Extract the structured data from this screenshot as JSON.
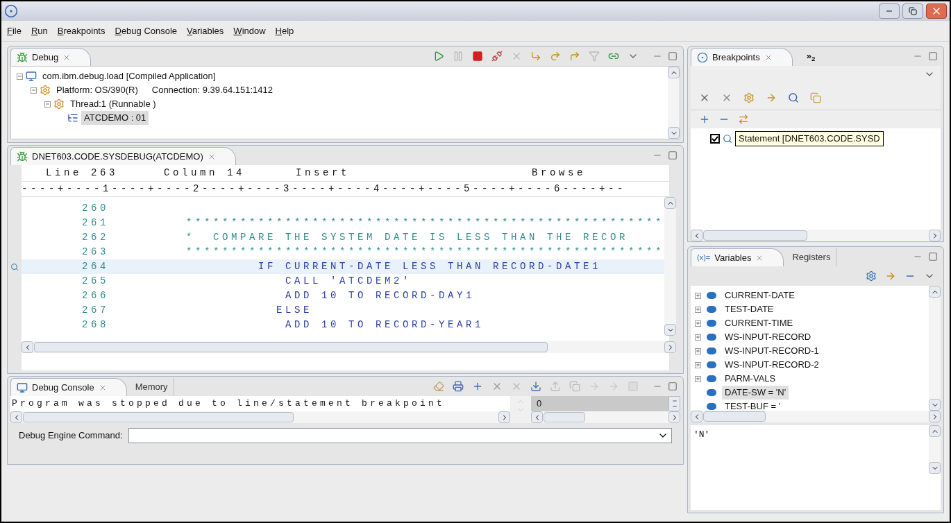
{
  "menu": [
    "File",
    "Run",
    "Breakpoints",
    "Debug Console",
    "Variables",
    "Window",
    "Help"
  ],
  "debug_view": {
    "tabs": [
      {
        "label": "Debug",
        "selected": true
      }
    ],
    "tree": [
      {
        "label": "com.ibm.debug.load [Compiled Application]",
        "kind": "application",
        "expanded": true,
        "selected": false,
        "children": [
          {
            "label": "Platform: OS/390(R)",
            "detail": "Connection: 9.39.64.151:1412",
            "kind": "platform",
            "expanded": true,
            "selected": false,
            "children": [
              {
                "label": "Thread:1 (Runnable )",
                "kind": "thread",
                "expanded": true,
                "selected": false,
                "children": [
                  {
                    "label": "ATCDEMO : 01",
                    "kind": "frame",
                    "selected": true
                  }
                ]
              }
            ]
          }
        ]
      }
    ]
  },
  "editor": {
    "tabs": [
      {
        "label": "DNET603.CODE.SYSDEBUG(ATCDEMO)",
        "selected": true
      }
    ],
    "status": [
      "Line 263",
      "Column 14",
      "Insert",
      "Browse"
    ],
    "ruler": "----+----1----+----2----+----3----+----4----+----5----+----6----+--",
    "lines": [
      {
        "number": "260",
        "selected": false,
        "breakpoint": false
      },
      {
        "number": "261",
        "text": "*****************************************************",
        "kind": "comment",
        "selected": false,
        "breakpoint": false
      },
      {
        "number": "262",
        "text": "*  COMPARE THE SYSTEM DATE IS LESS THAN THE RECOR",
        "kind": "comment",
        "selected": false,
        "breakpoint": false
      },
      {
        "number": "263",
        "text": "*****************************************************",
        "kind": "comment",
        "selected": false,
        "breakpoint": false
      },
      {
        "number": "264",
        "text": "        IF CURRENT-DATE LESS THAN RECORD-DATE1",
        "kind": "code",
        "selected": true,
        "breakpoint": true
      },
      {
        "number": "265",
        "text": "           CALL 'ATCDEM2'",
        "kind": "code",
        "selected": false,
        "breakpoint": false
      },
      {
        "number": "266",
        "text": "           ADD 10 TO RECORD-DAY1",
        "kind": "code",
        "selected": false,
        "breakpoint": false
      },
      {
        "number": "267",
        "text": "          ELSE",
        "kind": "code",
        "selected": false,
        "breakpoint": false
      },
      {
        "number": "268",
        "text": "           ADD 10 TO RECORD-YEAR1",
        "kind": "code",
        "selected": false,
        "breakpoint": false
      }
    ]
  },
  "console": {
    "tabs": [
      {
        "label": "Debug Console",
        "selected": true
      },
      {
        "label": "Memory",
        "selected": false
      }
    ],
    "output": "Program was stopped due to line/statement breakpoint",
    "value": "0",
    "command_label": "Debug Engine Command:"
  },
  "breakpoints": {
    "tabs": [
      {
        "label": "Breakpoints",
        "selected": true
      }
    ],
    "overflow": "»$_{2}$",
    "items": [
      {
        "label": "Statement [DNET603.CODE.SYSD",
        "checked": true
      }
    ]
  },
  "variables": {
    "tabs": [
      {
        "label": "Variables",
        "icon": "(x)=",
        "selected": true
      },
      {
        "label": "Registers",
        "selected": false
      }
    ],
    "items": [
      {
        "name": "CURRENT-DATE",
        "kind": "group",
        "selected": false
      },
      {
        "name": "TEST-DATE",
        "kind": "group",
        "selected": false
      },
      {
        "name": "CURRENT-TIME",
        "kind": "group",
        "selected": false
      },
      {
        "name": "WS-INPUT-RECORD",
        "kind": "group",
        "selected": false
      },
      {
        "name": "WS-INPUT-RECORD-1",
        "kind": "group",
        "selected": false
      },
      {
        "name": "WS-INPUT-RECORD-2",
        "kind": "group",
        "selected": false
      },
      {
        "name": "PARM-VALS",
        "kind": "group",
        "selected": false
      },
      {
        "name": "DATE-SW = 'N'",
        "kind": "value",
        "selected": true
      },
      {
        "name": "TEST-BUF = '",
        "kind": "value",
        "selected": false
      }
    ],
    "detail": "'N'"
  }
}
